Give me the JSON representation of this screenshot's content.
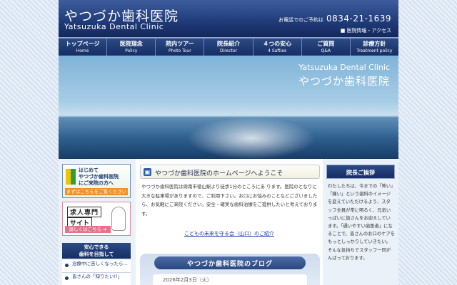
{
  "header": {
    "logo_jp": "やつづか歯科医院",
    "logo_en": "Yatsuzuka Dental Clinic",
    "phone_label": "お電話でのご予約は",
    "phone_number": "0834-21-1639",
    "access_mark": "■",
    "access_link": "医院情報・アクセス"
  },
  "nav": {
    "items": [
      {
        "jp": "トップページ",
        "en": "Home"
      },
      {
        "jp": "医院理念",
        "en": "Policy"
      },
      {
        "jp": "院内ツアー",
        "en": "Photo Tour"
      },
      {
        "jp": "院長紹介",
        "en": "Director"
      },
      {
        "jp": "４つの安心",
        "en": "4 Safties"
      },
      {
        "jp": "ご質問",
        "en": "Q&A"
      },
      {
        "jp": "診療方針",
        "en": "Treatment policy"
      }
    ]
  },
  "hero": {
    "en": "Yatsuzuka Dental Clinic",
    "jp": "やつづか歯科医院"
  },
  "left": {
    "banner1": {
      "line1": "はじめて",
      "line2": "やつづか歯科医院",
      "line3": "にご来院の方へ",
      "link": "まずはこちらをご覧ください"
    },
    "banner2": {
      "title": "求人専門",
      "sub": "サイト",
      "link": "詳しくはこちら ➜"
    },
    "section_head_1": "安心できる",
    "section_head_2": "歯科を目指して",
    "list": [
      "治療中に苦しくなったら…",
      "皆さんの「知りたい!!」"
    ]
  },
  "center": {
    "welcome_icon": "▣",
    "welcome_title": "やつづか歯科医院のホームページへようこそ",
    "welcome_text": "やつづか歯科医院は周南市徳山駅より徒歩1分のところにあ ります。医院のとなりに大きな駐車場がありますので、ご利用下さい。お口にお悩みのことなどございましたら、お気軽にご来院ください。安全・確実な歯科治療をご提供したいと考えております。",
    "link": "こどもの未来を守る会（山口）のご紹介",
    "blog_title": "やつづか歯科医院のブログ",
    "blog_date": "2026年2月3日（火）"
  },
  "right": {
    "greet_head": "院長ご挨拶",
    "greet_text": "わたしたちは、今までの「怖い」「痛い」という歯科のイメージを変えていただけるよう、スタッフ全員が常に明るく、元気いっぱいに皆さんをお迎えしています。「通いやすい歯医者」になることで、皆さんのお口のケアをもっとしっかりしていきたい。そんな気持ちでスタッフ一同がんばっております。"
  }
}
